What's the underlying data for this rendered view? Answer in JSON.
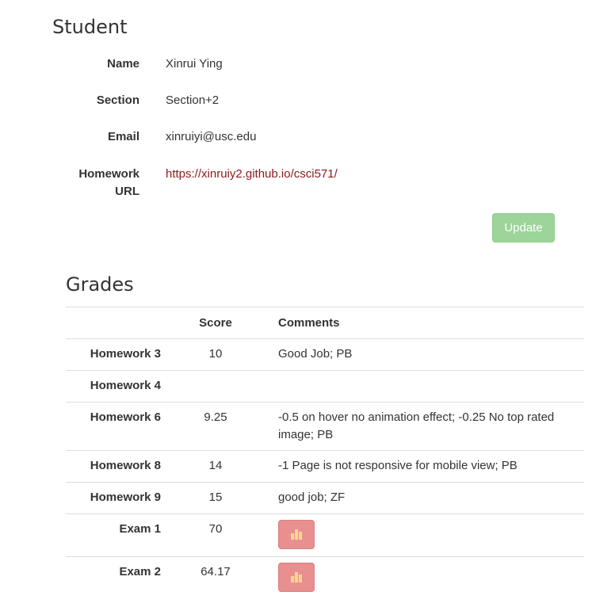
{
  "student": {
    "heading": "Student",
    "fields": [
      {
        "label": "Name",
        "value": "Xinrui Ying"
      },
      {
        "label": "Section",
        "value": "Section+2"
      },
      {
        "label": "Email",
        "value": "xinruiyi@usc.edu"
      },
      {
        "label_line1": "Homework",
        "label_line2": "URL",
        "value": "https://xinruiy2.github.io/csci571/"
      }
    ],
    "update_label": "Update"
  },
  "grades": {
    "heading": "Grades",
    "columns": {
      "name": "",
      "score": "Score",
      "comments": "Comments"
    },
    "rows": [
      {
        "name": "Homework 3",
        "score": "10",
        "comment": "Good Job; PB"
      },
      {
        "name": "Homework 4",
        "score": "",
        "comment": ""
      },
      {
        "name": "Homework 6",
        "score": "9.25",
        "comment": "-0.5 on hover no animation effect; -0.25 No top rated image; PB"
      },
      {
        "name": "Homework 8",
        "score": "14",
        "comment": "-1 Page is not responsive for mobile view; PB"
      },
      {
        "name": "Homework 9",
        "score": "15",
        "comment": "good job; ZF"
      },
      {
        "name": "Exam 1",
        "score": "70",
        "stats_icon": "bar-chart-icon"
      },
      {
        "name": "Exam 2",
        "score": "64.17",
        "stats_icon": "bar-chart-icon"
      }
    ]
  },
  "colors": {
    "link": "#8b1a1a",
    "update_button": "#9cd49a",
    "stats_button": "#e8908f",
    "stats_icon": "#f7d890"
  }
}
